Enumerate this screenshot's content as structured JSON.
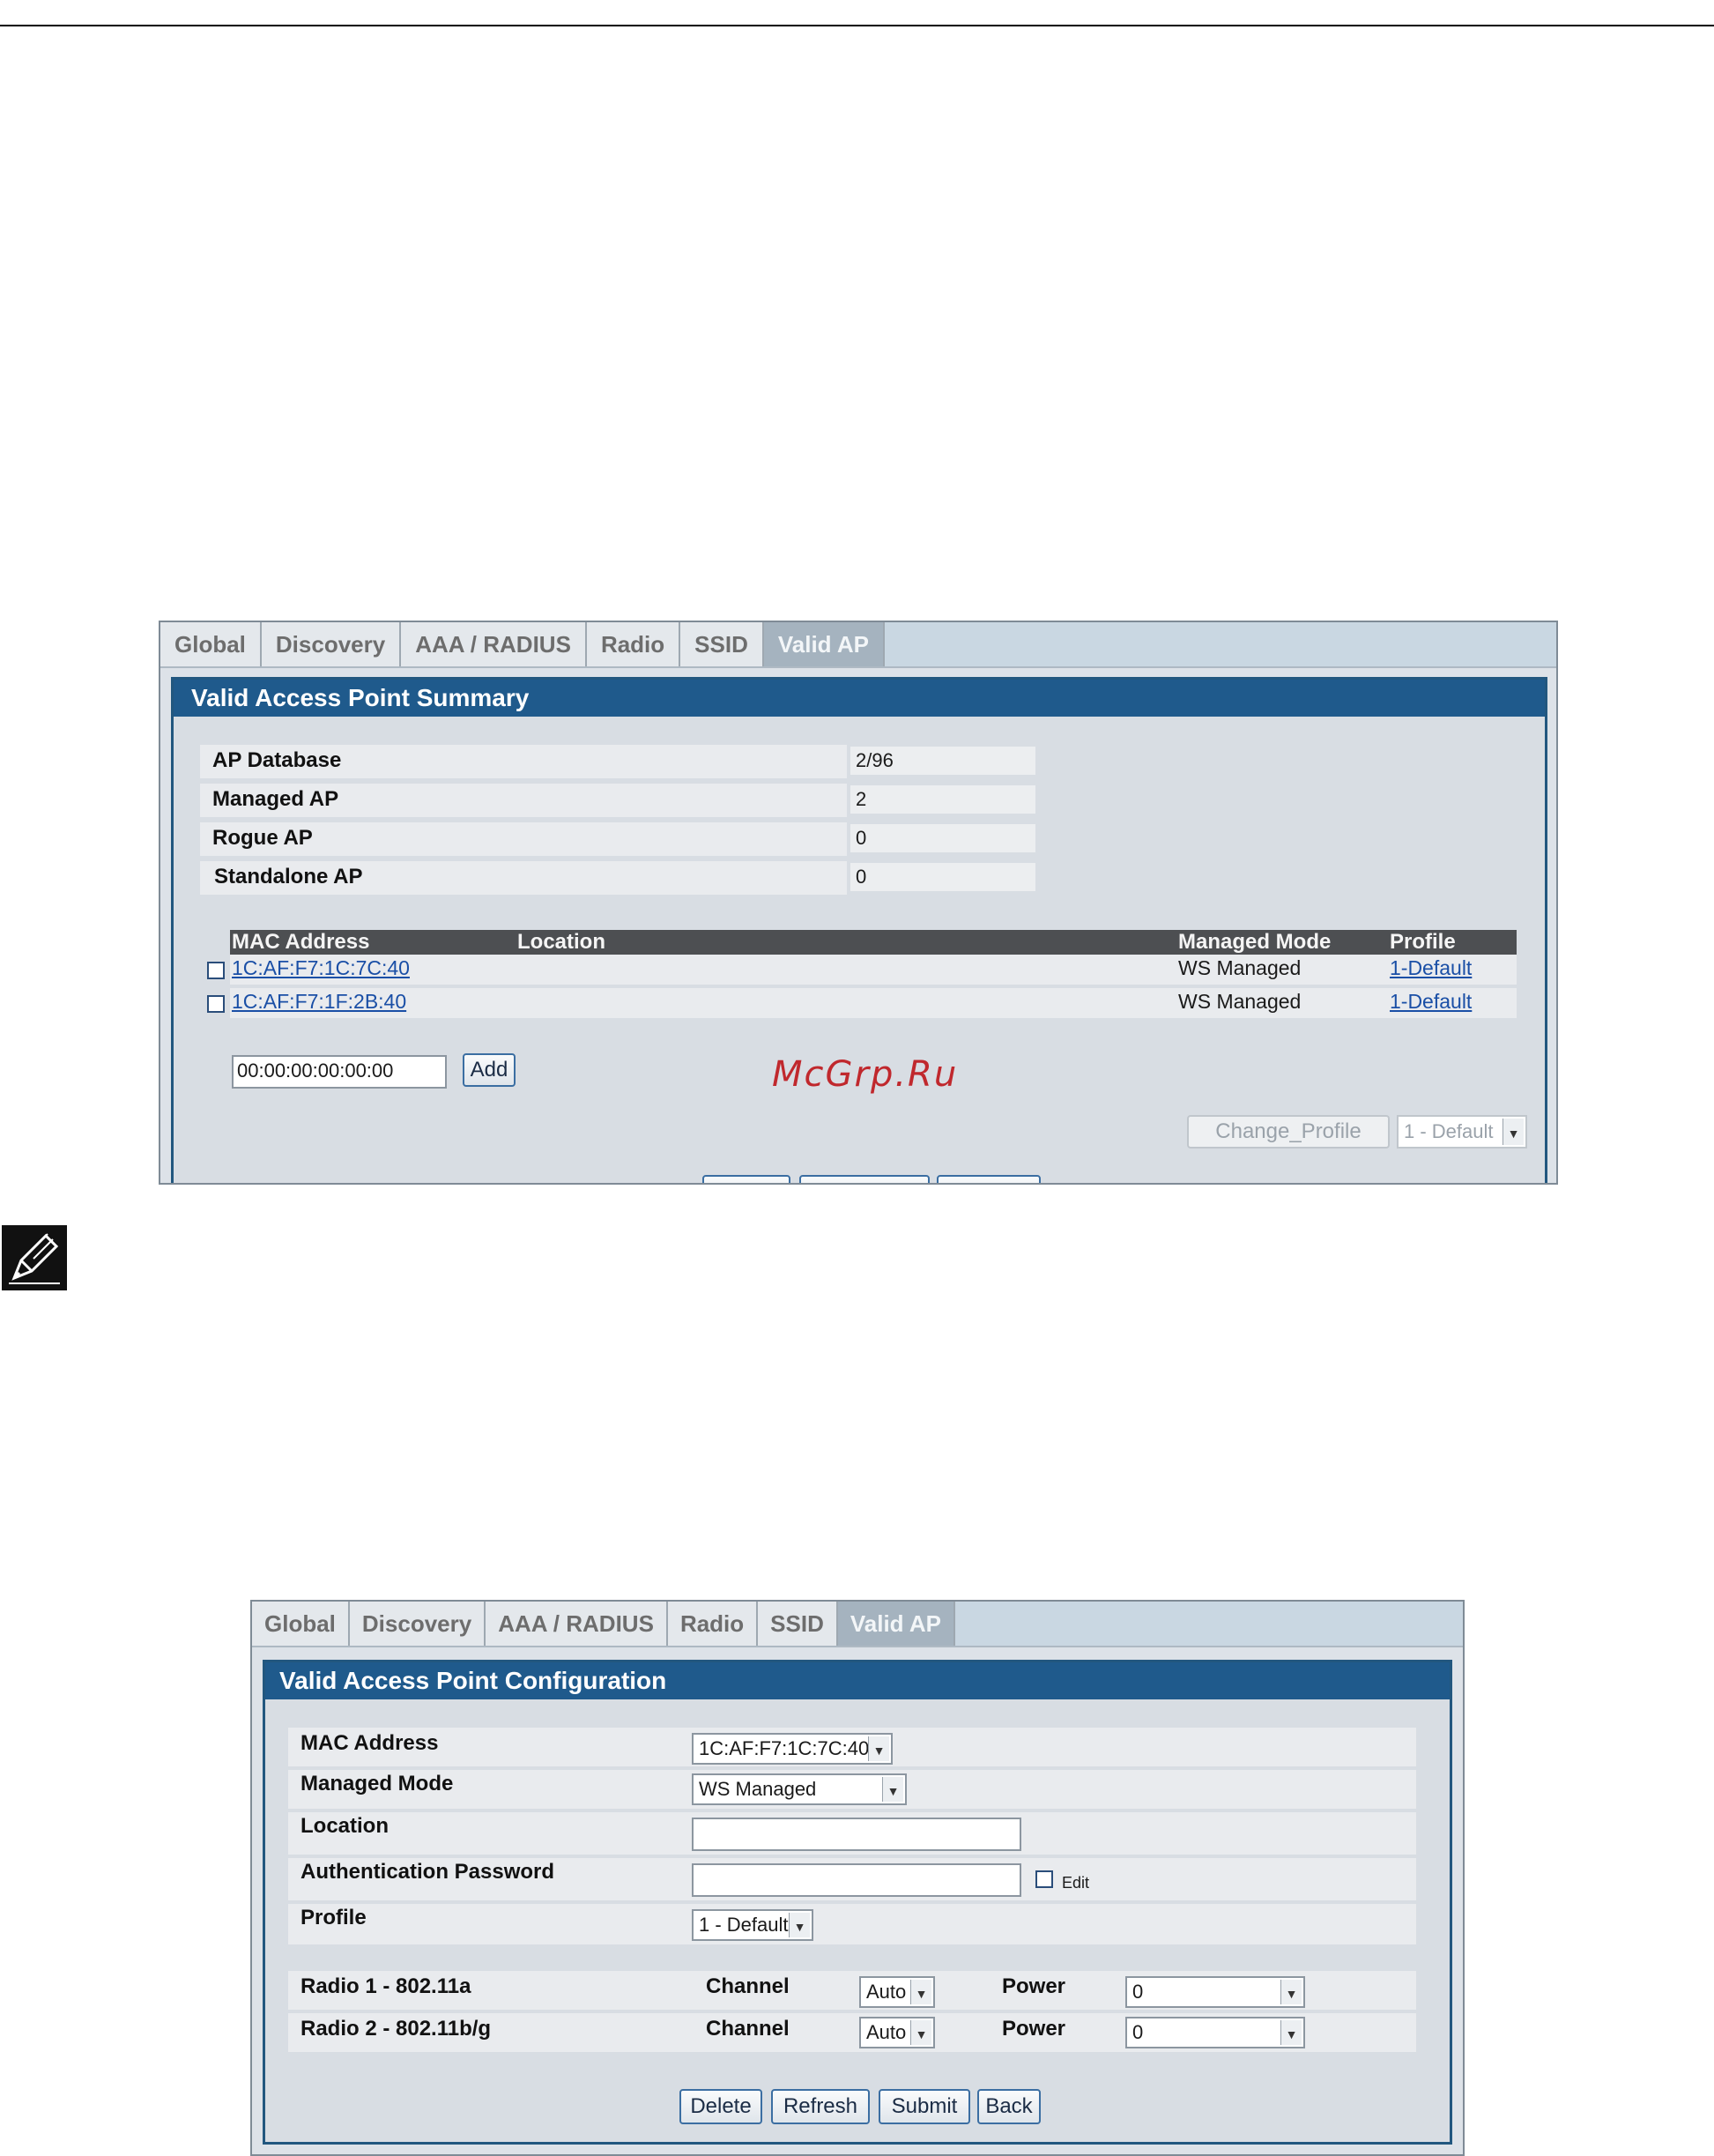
{
  "panel1": {
    "tabs": [
      "Global",
      "Discovery",
      "AAA / RADIUS",
      "Radio",
      "SSID",
      "Valid AP"
    ],
    "title": "Valid Access Point Summary",
    "stats": [
      {
        "label": "AP Database",
        "value": "2/96"
      },
      {
        "label": "Managed AP",
        "value": "2"
      },
      {
        "label": "Rogue AP",
        "value": "0"
      },
      {
        "label": "Standalone AP",
        "value": "0"
      }
    ],
    "table": {
      "headers": {
        "mac": "MAC Address",
        "location": "Location",
        "mode": "Managed Mode",
        "profile": "Profile"
      },
      "rows": [
        {
          "mac": "1C:AF:F7:1C:7C:40",
          "location": "",
          "mode": "WS Managed",
          "profile": "1-Default"
        },
        {
          "mac": "1C:AF:F7:1F:2B:40",
          "location": "",
          "mode": "WS Managed",
          "profile": "1-Default"
        }
      ]
    },
    "add_input_value": "00:00:00:00:00:00",
    "add_button": "Add",
    "change_profile_button": "Change_Profile",
    "profile_select": "1 - Default"
  },
  "watermark": "McGrp.Ru",
  "icons": {
    "note": "pencil-note-icon"
  },
  "panel2": {
    "tabs": [
      "Global",
      "Discovery",
      "AAA / RADIUS",
      "Radio",
      "SSID",
      "Valid AP"
    ],
    "title": "Valid Access Point Configuration",
    "fields": {
      "mac_label": "MAC Address",
      "mac_value": "1C:AF:F7:1C:7C:40",
      "mode_label": "Managed Mode",
      "mode_value": "WS Managed",
      "location_label": "Location",
      "location_value": "",
      "auth_label": "Authentication Password",
      "auth_value": "",
      "edit_label": "Edit",
      "profile_label": "Profile",
      "profile_value": "1 - Default"
    },
    "radios": [
      {
        "label": "Radio 1 - 802.11a",
        "channel_label": "Channel",
        "channel_value": "Auto",
        "power_label": "Power",
        "power_value": "0"
      },
      {
        "label": "Radio 2 - 802.11b/g",
        "channel_label": "Channel",
        "channel_value": "Auto",
        "power_label": "Power",
        "power_value": "0"
      }
    ],
    "buttons": {
      "delete": "Delete",
      "refresh": "Refresh",
      "submit": "Submit",
      "back": "Back"
    }
  },
  "colors": {
    "title_bar": "#1f5a8c",
    "tab_active": "#a5b3bf",
    "link": "#1a4fa6",
    "watermark": "#c0282d"
  }
}
